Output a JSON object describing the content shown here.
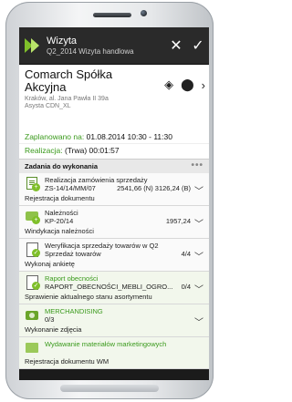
{
  "app": {
    "title": "Wizyta",
    "subtitle": "Q2_2014 Wizyta handlowa",
    "close_label": "✕",
    "confirm_label": "✓"
  },
  "header": {
    "company": "Comarch Spółka Akcyjna",
    "address": "Kraków, al. Jana Pawła II 39a",
    "person": "Asysta CDN_XL",
    "planned_label": "Zaplanowano na:",
    "planned_value": "01.08.2014 10:30 - 11:30",
    "realization_label": "Realizacja:",
    "realization_value": "(Trwa) 00:01:57"
  },
  "section": {
    "title": "Zadania do wykonania",
    "dots": "•••"
  },
  "tasks": [
    {
      "name": "Realizacja zamówienia sprzedaży",
      "ref": "ZS-14/14/MM/07",
      "value": "2541,66 (N) 3126,24 (B)",
      "work": "Rejestracja dokumentu",
      "icon": "document-icon"
    },
    {
      "name": "Należności",
      "ref": "KP-20/14",
      "value": "1957,24",
      "work": "Windykacja należności",
      "icon": "coins-icon"
    },
    {
      "name": "Weryfikacja sprzedaży towarów w Q2",
      "ref": "Sprzedaż towarów",
      "value": "4/4",
      "work": "Wykonaj ankietę",
      "icon": "survey-icon"
    },
    {
      "name": "Raport obecności",
      "ref": "RAPORT_OBECNOŚCI_MEBLI_OGRO...",
      "value": "0/4",
      "work": "Sprawienie aktualnego stanu asortymentu",
      "icon": "report-icon"
    },
    {
      "name": "MERCHANDISING",
      "ref": "0/3",
      "value": "",
      "work": "Wykonanie zdjęcia",
      "icon": "camera-icon"
    },
    {
      "name": "Wydawanie materiałów marketingowych",
      "ref": "",
      "value": "",
      "work": "Rejestracja dokumentu WM",
      "icon": "box-icon"
    }
  ],
  "colors": {
    "accent": "#3a9a1c",
    "titlebar": "#2a2a2a"
  }
}
